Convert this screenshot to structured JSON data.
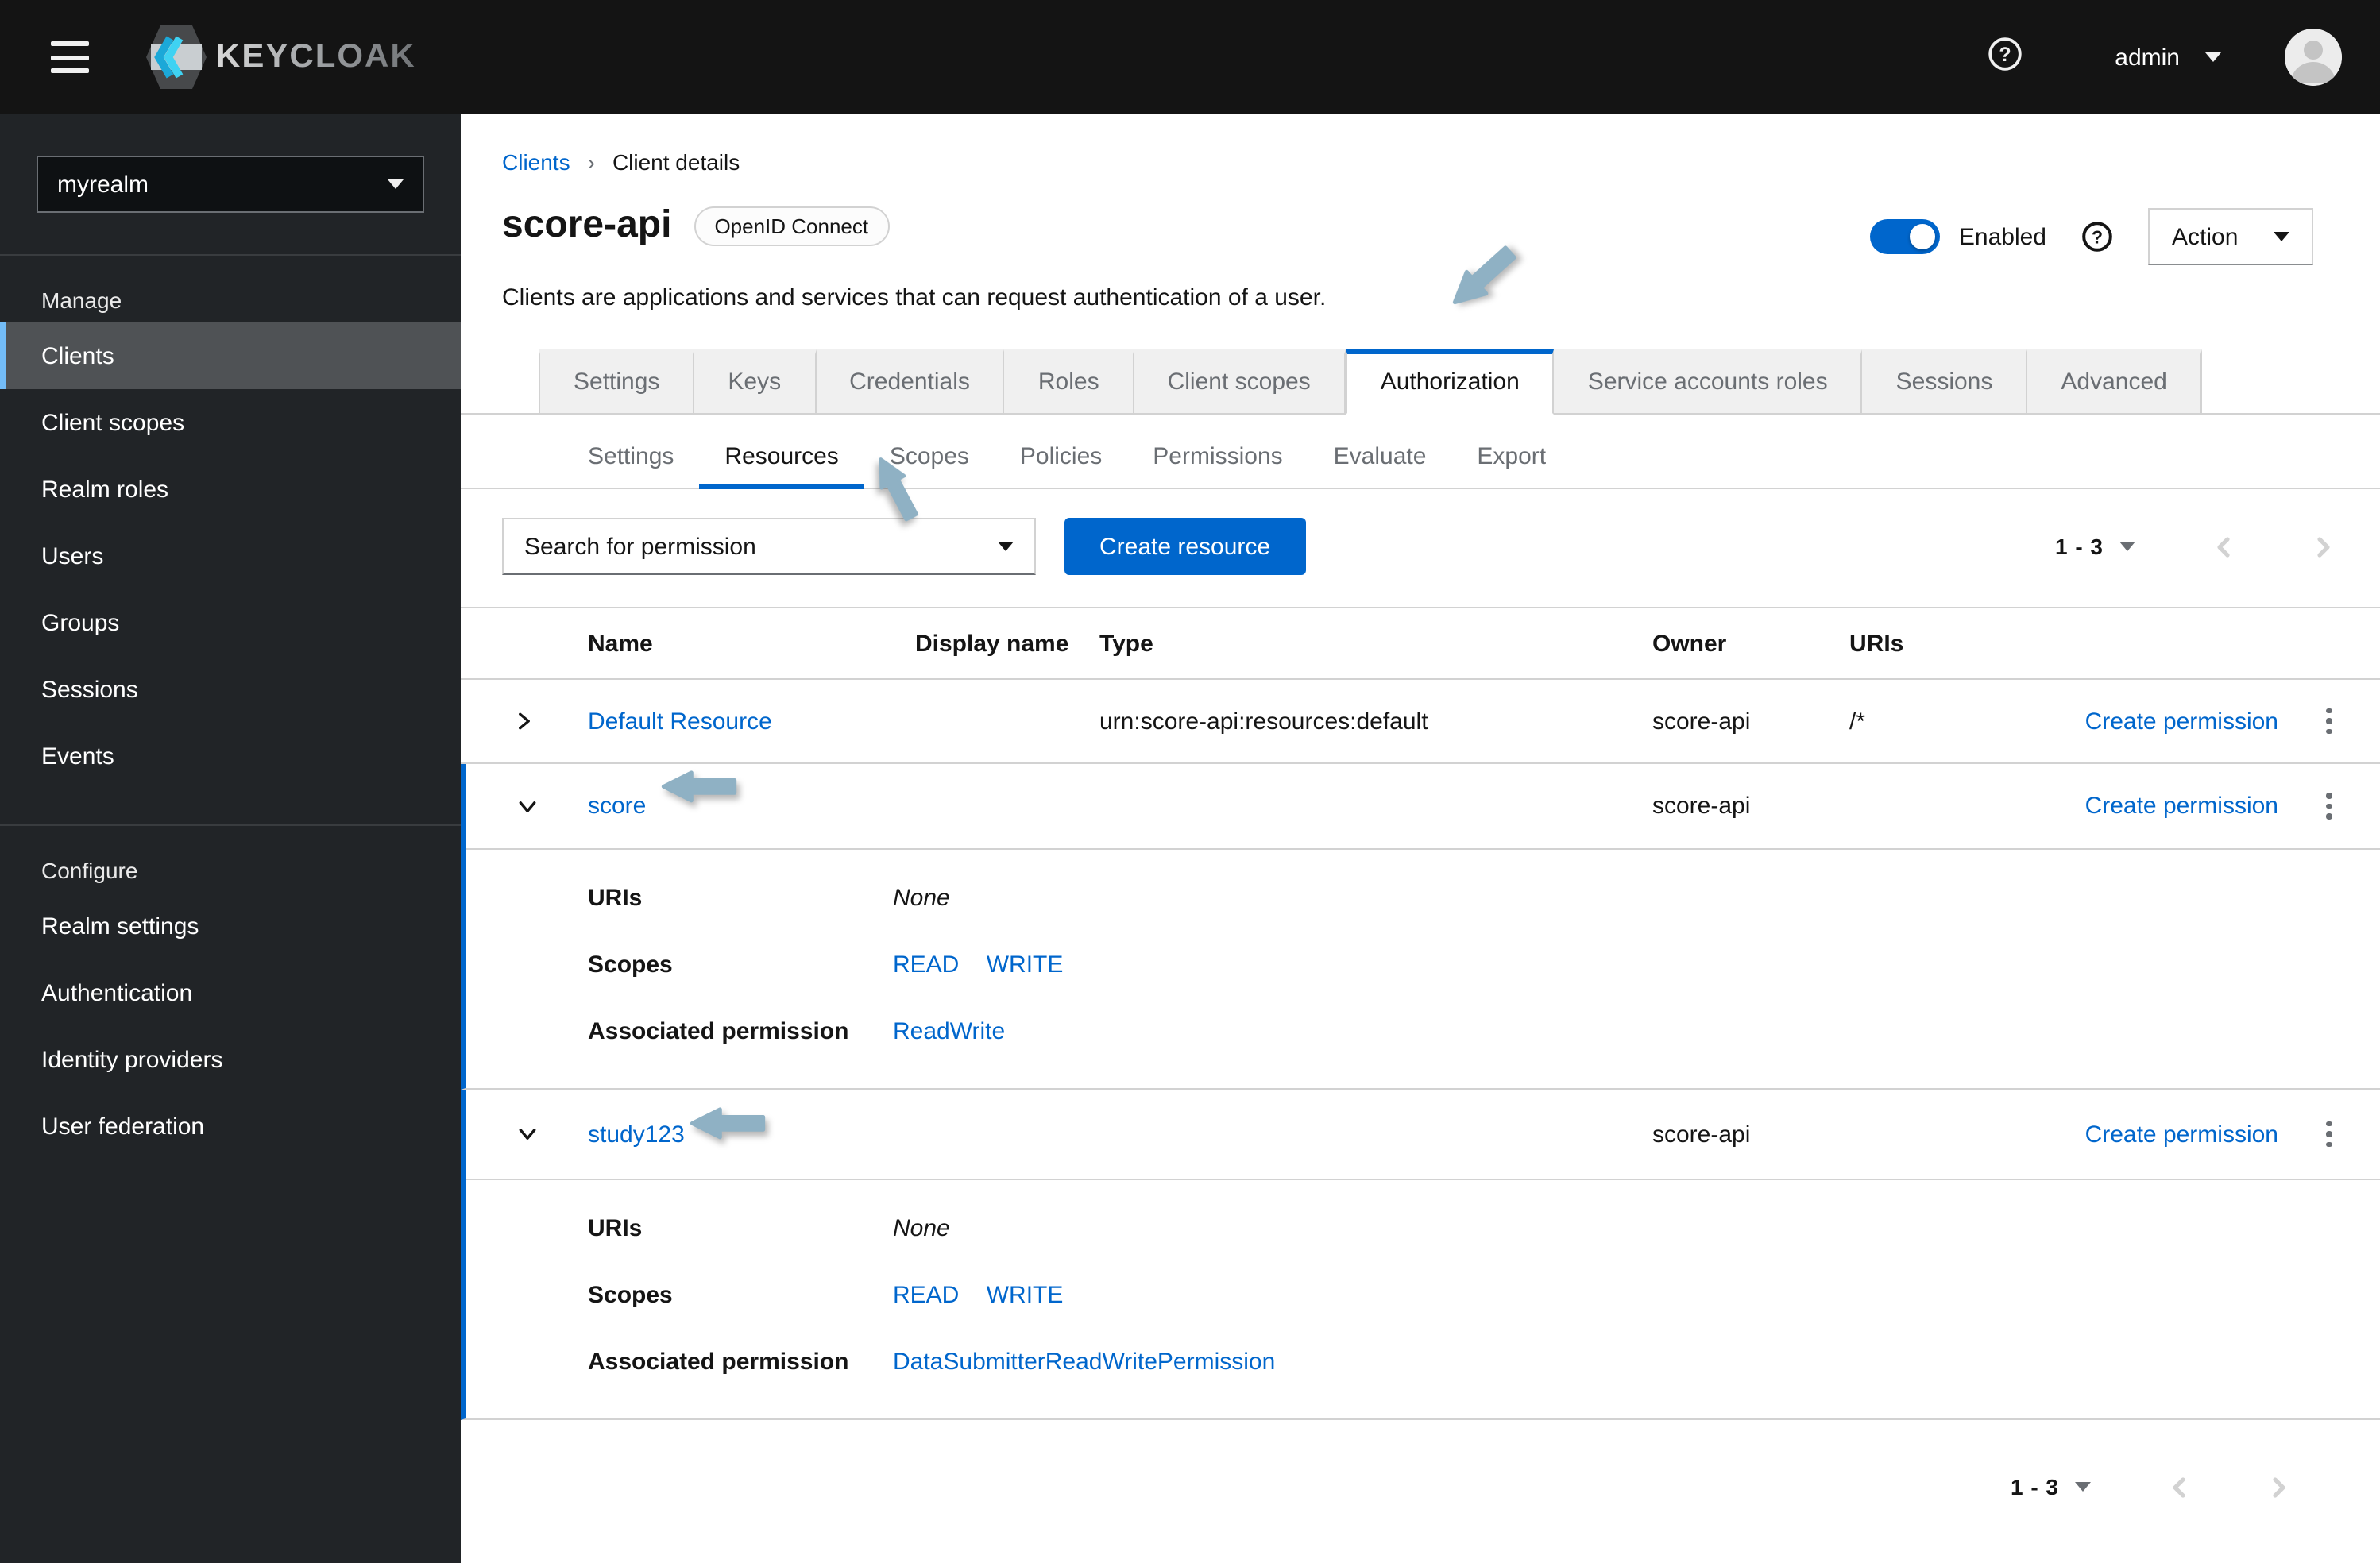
{
  "header": {
    "brand": "KEYCLOAK",
    "username": "admin"
  },
  "sidebar": {
    "realm": "myrealm",
    "sections": [
      {
        "title": "Manage",
        "items": [
          {
            "label": "Clients",
            "active": true
          },
          {
            "label": "Client scopes"
          },
          {
            "label": "Realm roles"
          },
          {
            "label": "Users"
          },
          {
            "label": "Groups"
          },
          {
            "label": "Sessions"
          },
          {
            "label": "Events"
          }
        ]
      },
      {
        "title": "Configure",
        "items": [
          {
            "label": "Realm settings"
          },
          {
            "label": "Authentication"
          },
          {
            "label": "Identity providers"
          },
          {
            "label": "User federation"
          }
        ]
      }
    ]
  },
  "breadcrumb": {
    "parent": "Clients",
    "current": "Client details"
  },
  "client": {
    "name": "score-api",
    "protocol": "OpenID Connect",
    "description": "Clients are applications and services that can request authentication of a user.",
    "enabled_label": "Enabled",
    "action_label": "Action"
  },
  "tabs": {
    "items": [
      {
        "label": "Settings"
      },
      {
        "label": "Keys"
      },
      {
        "label": "Credentials"
      },
      {
        "label": "Roles"
      },
      {
        "label": "Client scopes"
      },
      {
        "label": "Authorization",
        "active": true
      },
      {
        "label": "Service accounts roles"
      },
      {
        "label": "Sessions"
      },
      {
        "label": "Advanced"
      }
    ]
  },
  "subtabs": {
    "items": [
      {
        "label": "Settings"
      },
      {
        "label": "Resources",
        "active": true
      },
      {
        "label": "Scopes"
      },
      {
        "label": "Policies"
      },
      {
        "label": "Permissions"
      },
      {
        "label": "Evaluate"
      },
      {
        "label": "Export"
      }
    ]
  },
  "toolbar": {
    "search_placeholder": "Search for permission",
    "create_button": "Create resource"
  },
  "pagination": {
    "top": "1 - 3",
    "bottom": "1 - 3"
  },
  "table": {
    "columns": [
      "Name",
      "Display name",
      "Type",
      "Owner",
      "URIs"
    ],
    "rows": [
      {
        "name": "Default Resource",
        "display_name": "",
        "type": "urn:score-api:resources:default",
        "owner": "score-api",
        "uris": "/*",
        "action": "Create permission",
        "expanded": false
      },
      {
        "name": "score",
        "display_name": "",
        "type": "",
        "owner": "score-api",
        "uris": "",
        "action": "Create permission",
        "expanded": true,
        "details": {
          "uris_label": "URIs",
          "uris_value": "None",
          "scopes_label": "Scopes",
          "scopes": [
            "READ",
            "WRITE"
          ],
          "permission_label": "Associated permission",
          "permissions": [
            "ReadWrite"
          ]
        }
      },
      {
        "name": "study123",
        "display_name": "",
        "type": "",
        "owner": "score-api",
        "uris": "",
        "action": "Create permission",
        "expanded": true,
        "details": {
          "uris_label": "URIs",
          "uris_value": "None",
          "scopes_label": "Scopes",
          "scopes": [
            "READ",
            "WRITE"
          ],
          "permission_label": "Associated permission",
          "permissions": [
            "DataSubmitterReadWritePermission"
          ]
        }
      }
    ]
  },
  "colors": {
    "accent": "#0066cc",
    "annotation_arrow": "#8fb1c4",
    "nav_active_border": "#73bcf7"
  }
}
